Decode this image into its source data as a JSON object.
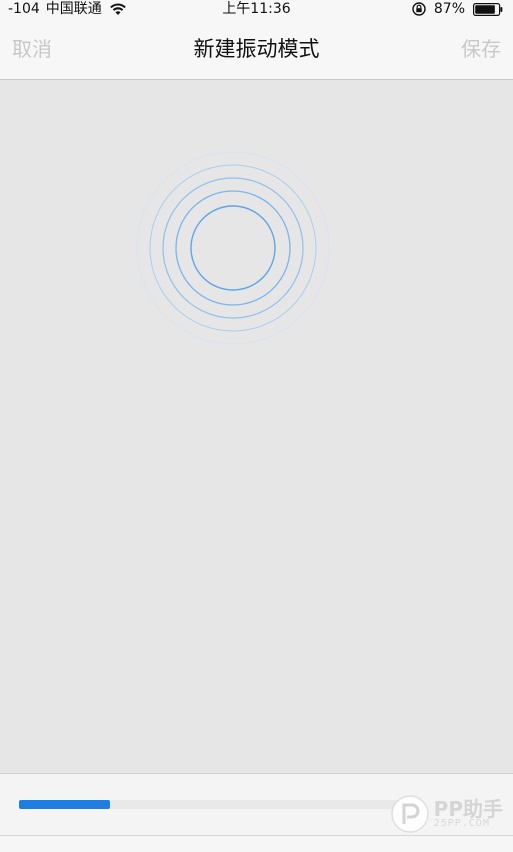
{
  "status_bar": {
    "signal": "-104",
    "carrier": "中国联通",
    "time": "上午11:36",
    "battery_percent": "87%",
    "battery_level": 0.87
  },
  "nav": {
    "cancel_label": "取消",
    "title": "新建振动模式",
    "save_label": "保存"
  },
  "timeline": {
    "progress": 0.24
  },
  "watermark": {
    "name": "PP助手",
    "sub": "25PP.COM"
  },
  "colors": {
    "accent": "#1f7fe0",
    "disabled_text": "#c8c8c8"
  },
  "icons": {
    "wifi": "wifi-icon",
    "lock": "rotation-lock-icon",
    "battery": "battery-icon",
    "ripple": "vibration-ripple-icon"
  }
}
